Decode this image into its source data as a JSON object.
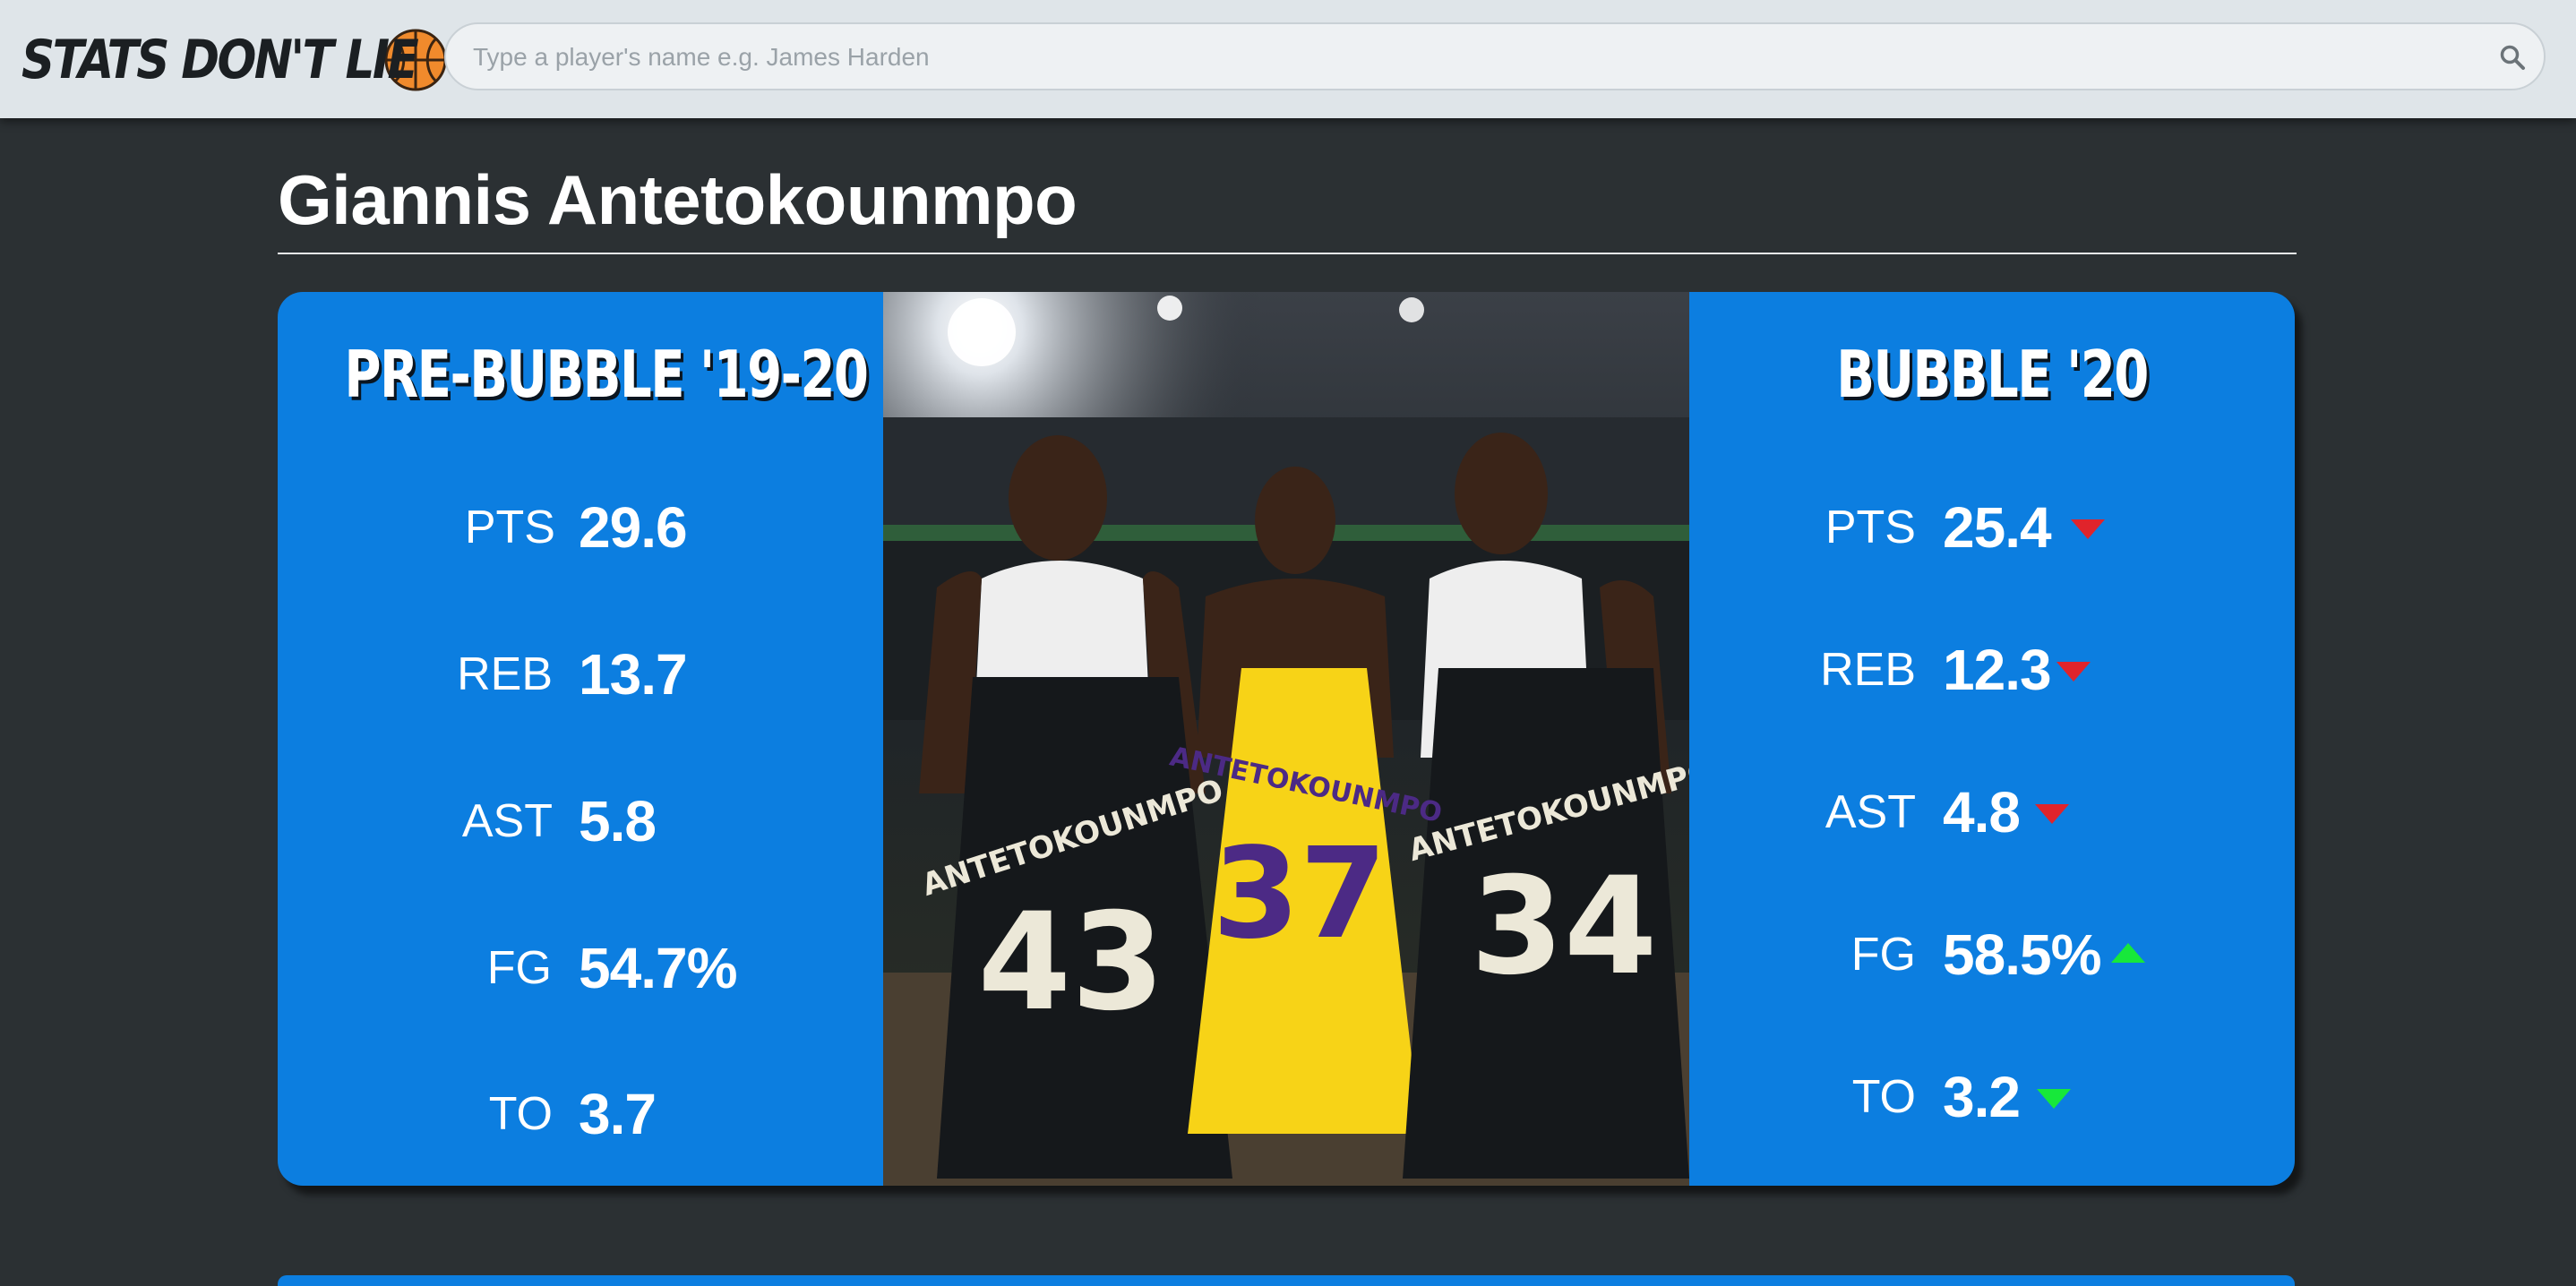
{
  "app": {
    "logo_text": "STATS DON'T LIE",
    "logo_icon": "basketball-icon"
  },
  "search": {
    "placeholder": "Type a player's name e.g. James Harden",
    "value": "",
    "icon": "search-icon"
  },
  "player": {
    "name": "Giannis Antetokounmpo"
  },
  "pre_bubble": {
    "title": "PRE-BUBBLE '19-20",
    "stats": [
      {
        "label": "PTS",
        "value": "29.6"
      },
      {
        "label": "REB",
        "value": "13.7"
      },
      {
        "label": "AST",
        "value": "5.8"
      },
      {
        "label": "FG",
        "value": "54.7%"
      },
      {
        "label": "TO",
        "value": "3.7"
      }
    ]
  },
  "bubble": {
    "title": "BUBBLE '20",
    "stats": [
      {
        "label": "PTS",
        "value": "25.4",
        "trend": "down",
        "trend_color": "#e0242b"
      },
      {
        "label": "REB",
        "value": "12.3",
        "trend": "down",
        "trend_color": "#e0242b"
      },
      {
        "label": "AST",
        "value": "4.8",
        "trend": "down",
        "trend_color": "#e0242b"
      },
      {
        "label": "FG",
        "value": "58.5%",
        "trend": "up",
        "trend_color": "#17e83a"
      },
      {
        "label": "TO",
        "value": "3.2",
        "trend": "down",
        "trend_color": "#17e83a"
      }
    ]
  },
  "photo": {
    "jerseys": [
      {
        "name": "ANTETOKOUNMPO",
        "number": "43"
      },
      {
        "name": "ANTETOKOUNMPO",
        "number": "37"
      },
      {
        "name": "ANTETOKOUNMPO",
        "number": "34"
      }
    ]
  },
  "colors": {
    "card_blue": "#0c7ee0",
    "background": "#2b3033",
    "topbar": "#dfe5e9",
    "down_red": "#e0242b",
    "good_green": "#17e83a"
  }
}
